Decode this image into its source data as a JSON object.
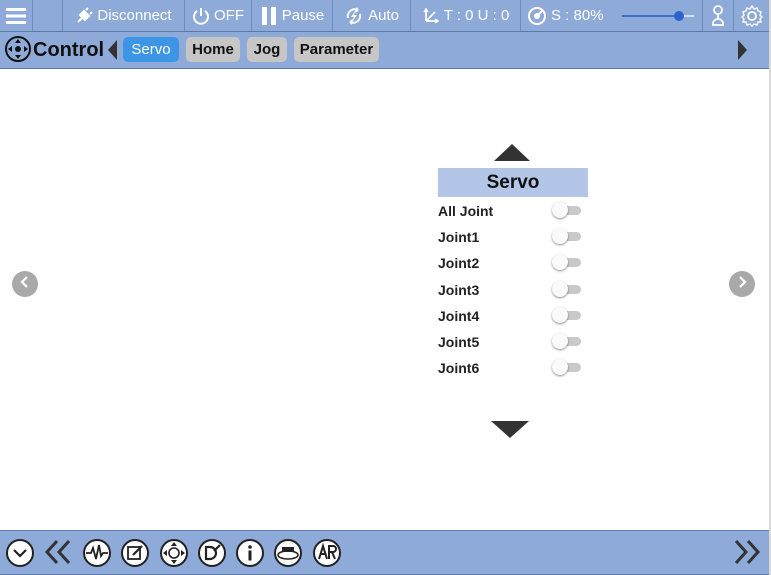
{
  "status_bar": {
    "disconnect_label": "Disconnect",
    "power_label": "OFF",
    "pause_label": "Pause",
    "mode_label": "Auto",
    "tou_label": "T : 0 U : 0",
    "speed_label": "S : 80%",
    "speed_value_percent": 80,
    "accent_color": "#8eaad8"
  },
  "nav": {
    "title": "Control",
    "tabs": [
      {
        "label": "Servo",
        "active": true
      },
      {
        "label": "Home",
        "active": false
      },
      {
        "label": "Jog",
        "active": false
      },
      {
        "label": "Parameter",
        "active": false
      }
    ]
  },
  "servo": {
    "title": "Servo",
    "rows": [
      {
        "label": "All Joint",
        "enabled": false
      },
      {
        "label": "Joint1",
        "enabled": false
      },
      {
        "label": "Joint2",
        "enabled": false
      },
      {
        "label": "Joint3",
        "enabled": false
      },
      {
        "label": "Joint4",
        "enabled": false
      },
      {
        "label": "Joint5",
        "enabled": false
      },
      {
        "label": "Joint6",
        "enabled": false
      }
    ]
  },
  "icons": {
    "top": [
      "menu-icon",
      "plug-icon",
      "power-icon",
      "pause-icon",
      "auto-icon",
      "axis-icon",
      "speed-icon",
      "user-icon",
      "gear-icon"
    ],
    "bottom": [
      "collapse-icon",
      "double-chevron-left-icon",
      "waveform-icon",
      "edit-icon",
      "move-icon",
      "program-icon",
      "info-icon",
      "rotate-360-icon",
      "ar-icon",
      "double-chevron-right-icon"
    ]
  }
}
